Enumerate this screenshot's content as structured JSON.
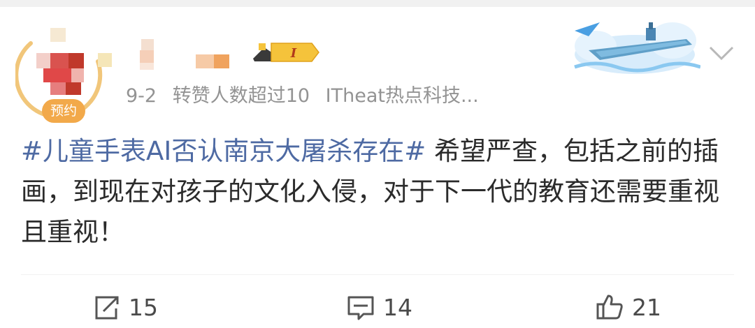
{
  "post": {
    "badge": "预约",
    "vip_level": "I",
    "meta": {
      "date": "9-2",
      "likes_note": "转赞人数超过10",
      "source": "ITheat热点科技..."
    },
    "hashtag": "#儿童手表AI否认南京大屠杀存在#",
    "body": "希望严查，包括之前的插画，到现在对孩子的文化入侵，对于下一代的教育还需要重视且重视！",
    "stats": {
      "reposts": "15",
      "comments": "14",
      "likes": "21"
    }
  },
  "icons": {
    "repost": "share-icon",
    "comment": "comment-icon",
    "like": "thumbs-up-icon",
    "more": "chevron-down-icon"
  },
  "colors": {
    "hashtag": "#4e6aa3",
    "meta_text": "#939393",
    "badge": "#f2a94a",
    "vip_gold": "#f5c33b"
  }
}
